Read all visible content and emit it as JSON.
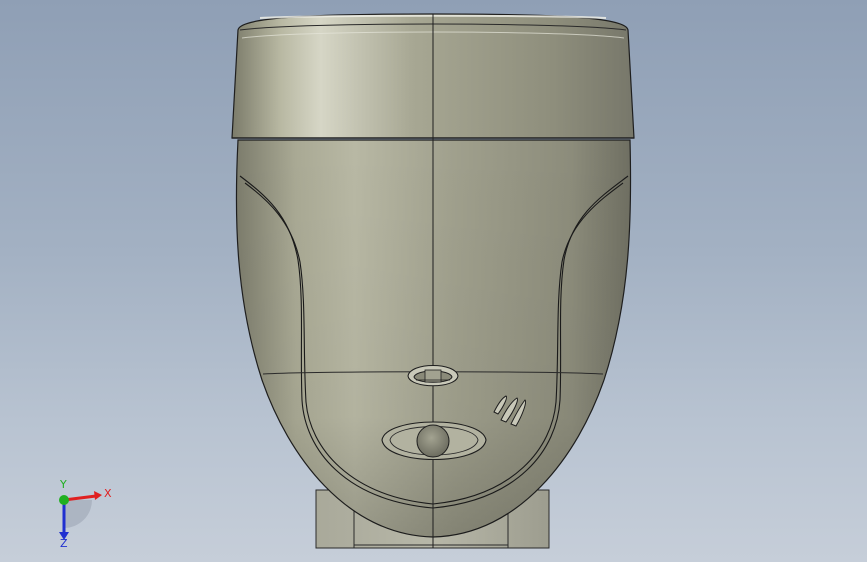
{
  "viewport": {
    "background_top": "#8f9fb5",
    "background_bottom": "#c6ced9"
  },
  "model": {
    "body_color": "#a8a894",
    "edge_color": "#1e1e1e",
    "highlight_color": "#dcdccc"
  },
  "triad": {
    "x_label": "X",
    "y_label": "Y",
    "z_label": "Z",
    "x_color": "#e02020",
    "y_color": "#20b020",
    "z_color": "#2030d0"
  }
}
